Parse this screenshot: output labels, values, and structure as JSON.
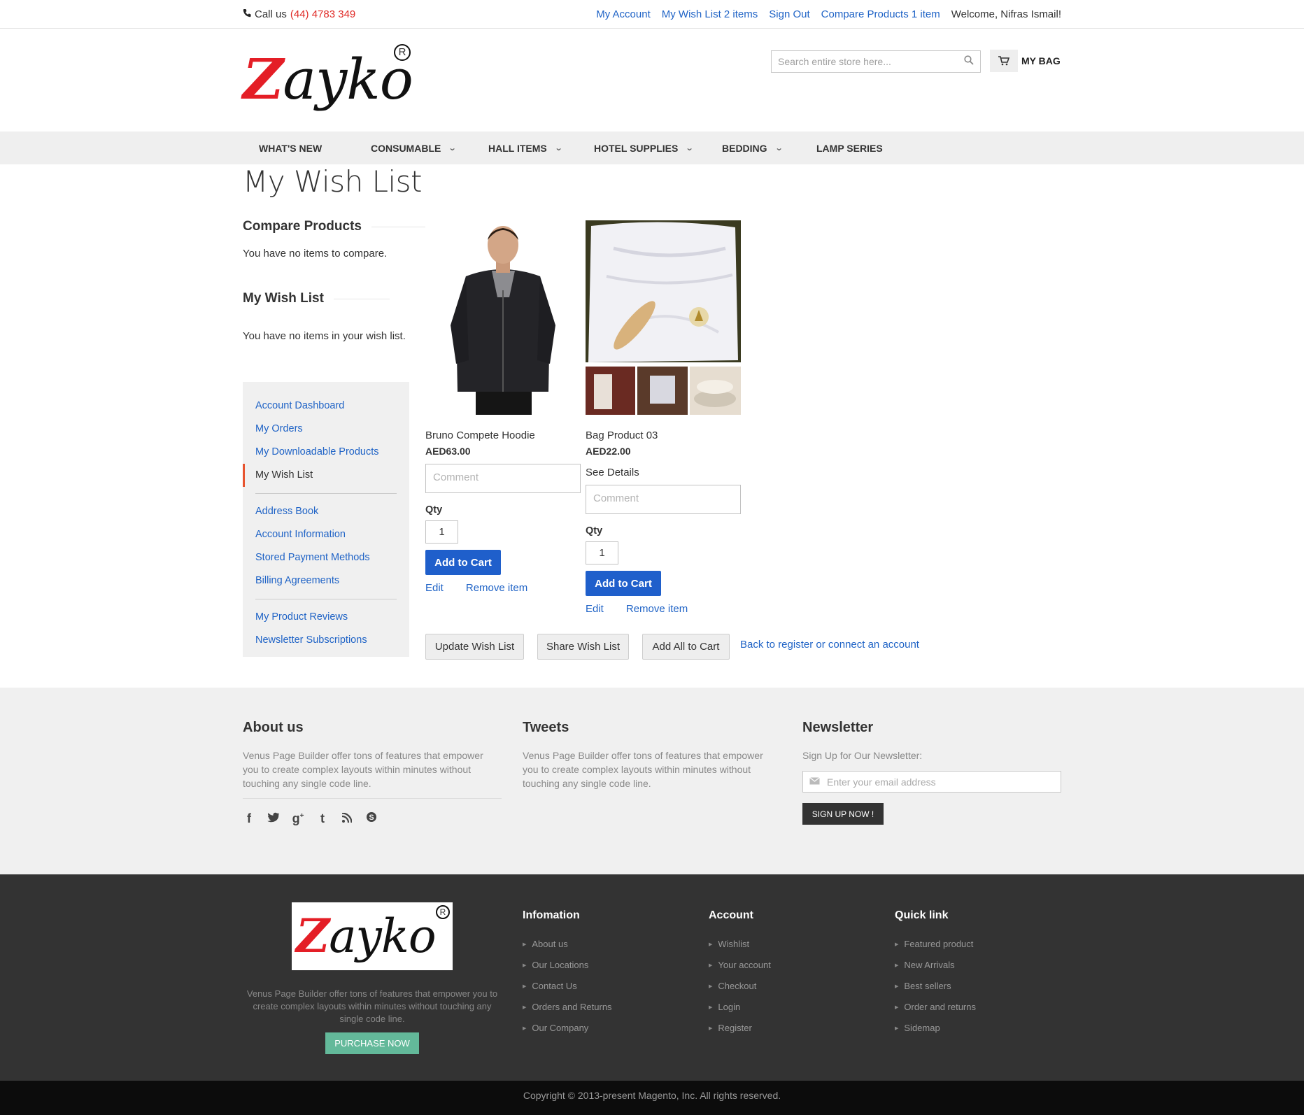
{
  "topbar": {
    "call_label": "Call us",
    "phone": "(44) 4783 349",
    "links": [
      "My Account",
      "My Wish List 2 items",
      "Sign Out",
      "Compare Products 1 item"
    ],
    "welcome": "Welcome, Nifras Ismail!"
  },
  "header": {
    "logo_z": "Z",
    "logo_rest": "ayko",
    "logo_reg": "R",
    "search_placeholder": "Search entire store here...",
    "bag_label": "MY BAG"
  },
  "nav": {
    "items": [
      {
        "label": "WHAT'S NEW"
      },
      {
        "label": "CONSUMABLE"
      },
      {
        "label": "HALL ITEMS"
      },
      {
        "label": "HOTEL SUPPLIES"
      },
      {
        "label": "BEDDING"
      },
      {
        "label": "LAMP SERIES"
      }
    ]
  },
  "page": {
    "title": "My Wish List"
  },
  "sidebar": {
    "compare_title": "Compare Products",
    "compare_text": "You have no items to compare.",
    "wishlist_title": "My Wish List",
    "wishlist_text": "You have no items in your wish list.",
    "account_nav": [
      "Account Dashboard",
      "My Orders",
      "My Downloadable Products",
      "My Wish List",
      "Address Book",
      "Account Information",
      "Stored Payment Methods",
      "Billing Agreements",
      "My Product Reviews",
      "Newsletter Subscriptions"
    ]
  },
  "products": [
    {
      "name": "Bruno Compete Hoodie",
      "price": "AED63.00",
      "comment_placeholder": "Comment",
      "qty_label": "Qty",
      "qty": "1",
      "add_label": "Add to Cart",
      "edit_label": "Edit",
      "remove_label": "Remove item"
    },
    {
      "name": "Bag Product 03",
      "price": "AED22.00",
      "details_label": "See Details",
      "comment_placeholder": "Comment",
      "qty_label": "Qty",
      "qty": "1",
      "add_label": "Add to Cart",
      "edit_label": "Edit",
      "remove_label": "Remove item"
    }
  ],
  "wishlist_actions": {
    "update": "Update Wish List",
    "share": "Share Wish List",
    "add_all": "Add All to Cart",
    "back_link": "Back to register or connect an account"
  },
  "footer_top": {
    "about_title": "About us",
    "about_text": "Venus Page Builder offer tons of features that empower you to create complex layouts within minutes without touching any single code line.",
    "tweets_title": "Tweets",
    "tweets_text": "Venus Page Builder offer tons of features that empower you to create complex layouts within minutes without touching any single code line.",
    "newsletter_title": "Newsletter",
    "newsletter_label": "Sign Up for Our Newsletter:",
    "newsletter_placeholder": "Enter your email address",
    "signup_label": "SIGN UP NOW !",
    "social_icons": [
      "facebook-icon",
      "twitter-icon",
      "google-plus-icon",
      "tumblr-icon",
      "rss-icon",
      "skype-icon"
    ]
  },
  "footer_bottom": {
    "text": "Venus Page Builder offer tons of features that empower you to create complex layouts within minutes without touching any single code line.",
    "purchase_label": "PURCHASE NOW",
    "columns": [
      {
        "title": "Infomation",
        "links": [
          "About us",
          "Our Locations",
          "Contact Us",
          "Orders and Returns",
          "Our Company"
        ]
      },
      {
        "title": "Account",
        "links": [
          "Wishlist",
          "Your account",
          "Checkout",
          "Login",
          "Register"
        ]
      },
      {
        "title": "Quick link",
        "links": [
          "Featured product",
          "New Arrivals",
          "Best sellers",
          "Order and returns",
          "Sidemap"
        ]
      }
    ],
    "copyright": "Copyright © 2013-present Magento, Inc. All rights reserved."
  },
  "colors": {
    "link": "#1f63c6",
    "phone": "#e02b27",
    "primary_button": "#1f5fcb",
    "purchase_button": "#63b99a",
    "active_marker": "#e7542f"
  }
}
